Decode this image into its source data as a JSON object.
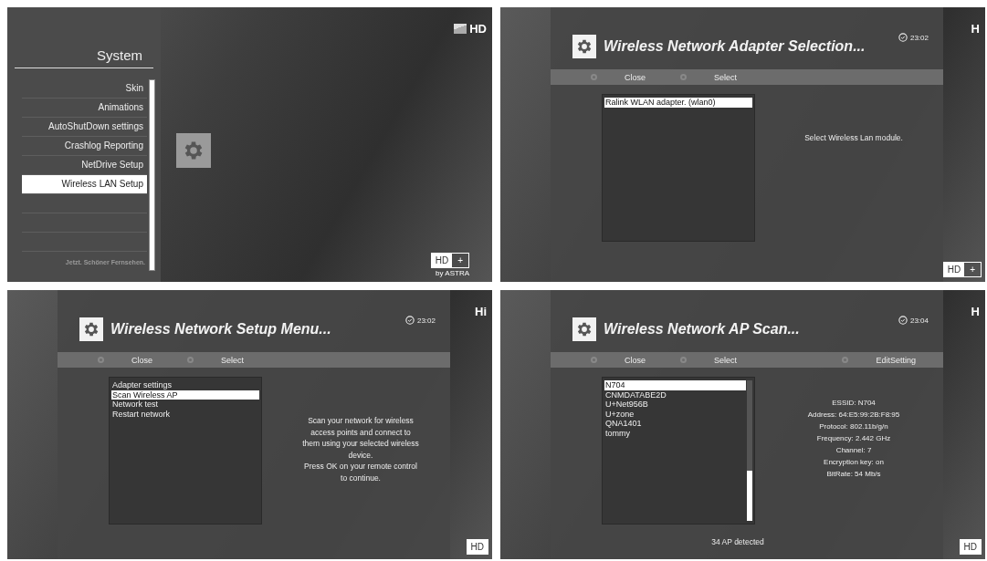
{
  "panels": [
    {
      "kind": "system_menu",
      "title": "System",
      "items": [
        {
          "label": "Skin",
          "selected": false
        },
        {
          "label": "Animations",
          "selected": false
        },
        {
          "label": "AutoShutDown settings",
          "selected": false
        },
        {
          "label": "Crashlog Reporting",
          "selected": false
        },
        {
          "label": "NetDrive Setup",
          "selected": false
        },
        {
          "label": "Wireless LAN Setup",
          "selected": true
        }
      ],
      "slogan": "Jetzt. Schöner Fernsehen.",
      "channel_logo": "HD",
      "badge": {
        "left": "HD",
        "right": "+",
        "caption": "by ASTRA"
      }
    },
    {
      "kind": "dialog",
      "title": "Wireless Network Adapter Selection...",
      "time": "23:02",
      "buttons": [
        {
          "label": "Close"
        },
        {
          "label": "Select"
        }
      ],
      "list": {
        "items": [
          {
            "label": "Ralink WLAN adapter. (wlan0)",
            "selected": true
          }
        ]
      },
      "description": [
        "Select Wireless Lan module."
      ],
      "channel_logo": "H",
      "badge": {
        "left": "HD",
        "right": "+"
      }
    },
    {
      "kind": "dialog",
      "title": "Wireless Network Setup Menu...",
      "time": "23:02",
      "buttons": [
        {
          "label": "Close"
        },
        {
          "label": "Select"
        }
      ],
      "list": {
        "items": [
          {
            "label": "Adapter settings",
            "selected": false
          },
          {
            "label": "Scan Wireless AP",
            "selected": true
          },
          {
            "label": "Network test",
            "selected": false
          },
          {
            "label": "Restart network",
            "selected": false
          }
        ]
      },
      "description": [
        "Scan your network for wireless",
        "access points and connect to",
        "them using your selected wireless",
        "device.",
        "Press OK on your remote control",
        "to continue."
      ],
      "channel_logo": "Hi",
      "badge": {
        "left": "HD"
      }
    },
    {
      "kind": "dialog",
      "title": "Wireless Network AP Scan...",
      "time": "23:04",
      "buttons": [
        {
          "label": "Close"
        },
        {
          "label": "Select"
        },
        {
          "label": "EditSetting"
        }
      ],
      "list": {
        "scrollbar": true,
        "items": [
          {
            "label": "N704",
            "selected": true
          },
          {
            "label": "CNMDATABE2D",
            "selected": false
          },
          {
            "label": "U+Net956B",
            "selected": false
          },
          {
            "label": "U+zone",
            "selected": false
          },
          {
            "label": "QNA1401",
            "selected": false
          },
          {
            "label": "tommy",
            "selected": false
          }
        ]
      },
      "details": [
        {
          "label": "ESSID:",
          "value": "N704"
        },
        {
          "label": "Address:",
          "value": "64:E5:99:2B:F8:95"
        },
        {
          "label": "Protocol:",
          "value": "802.11b/g/n"
        },
        {
          "label": "Frequency:",
          "value": "2.442 GHz"
        },
        {
          "label": "Channel:",
          "value": "7"
        },
        {
          "label": "Encryption key:",
          "value": "on"
        },
        {
          "label": "BitRate:",
          "value": "54 Mb/s"
        }
      ],
      "footer": "34 AP detected",
      "channel_logo": "H",
      "badge": {
        "left": "HD"
      }
    }
  ]
}
